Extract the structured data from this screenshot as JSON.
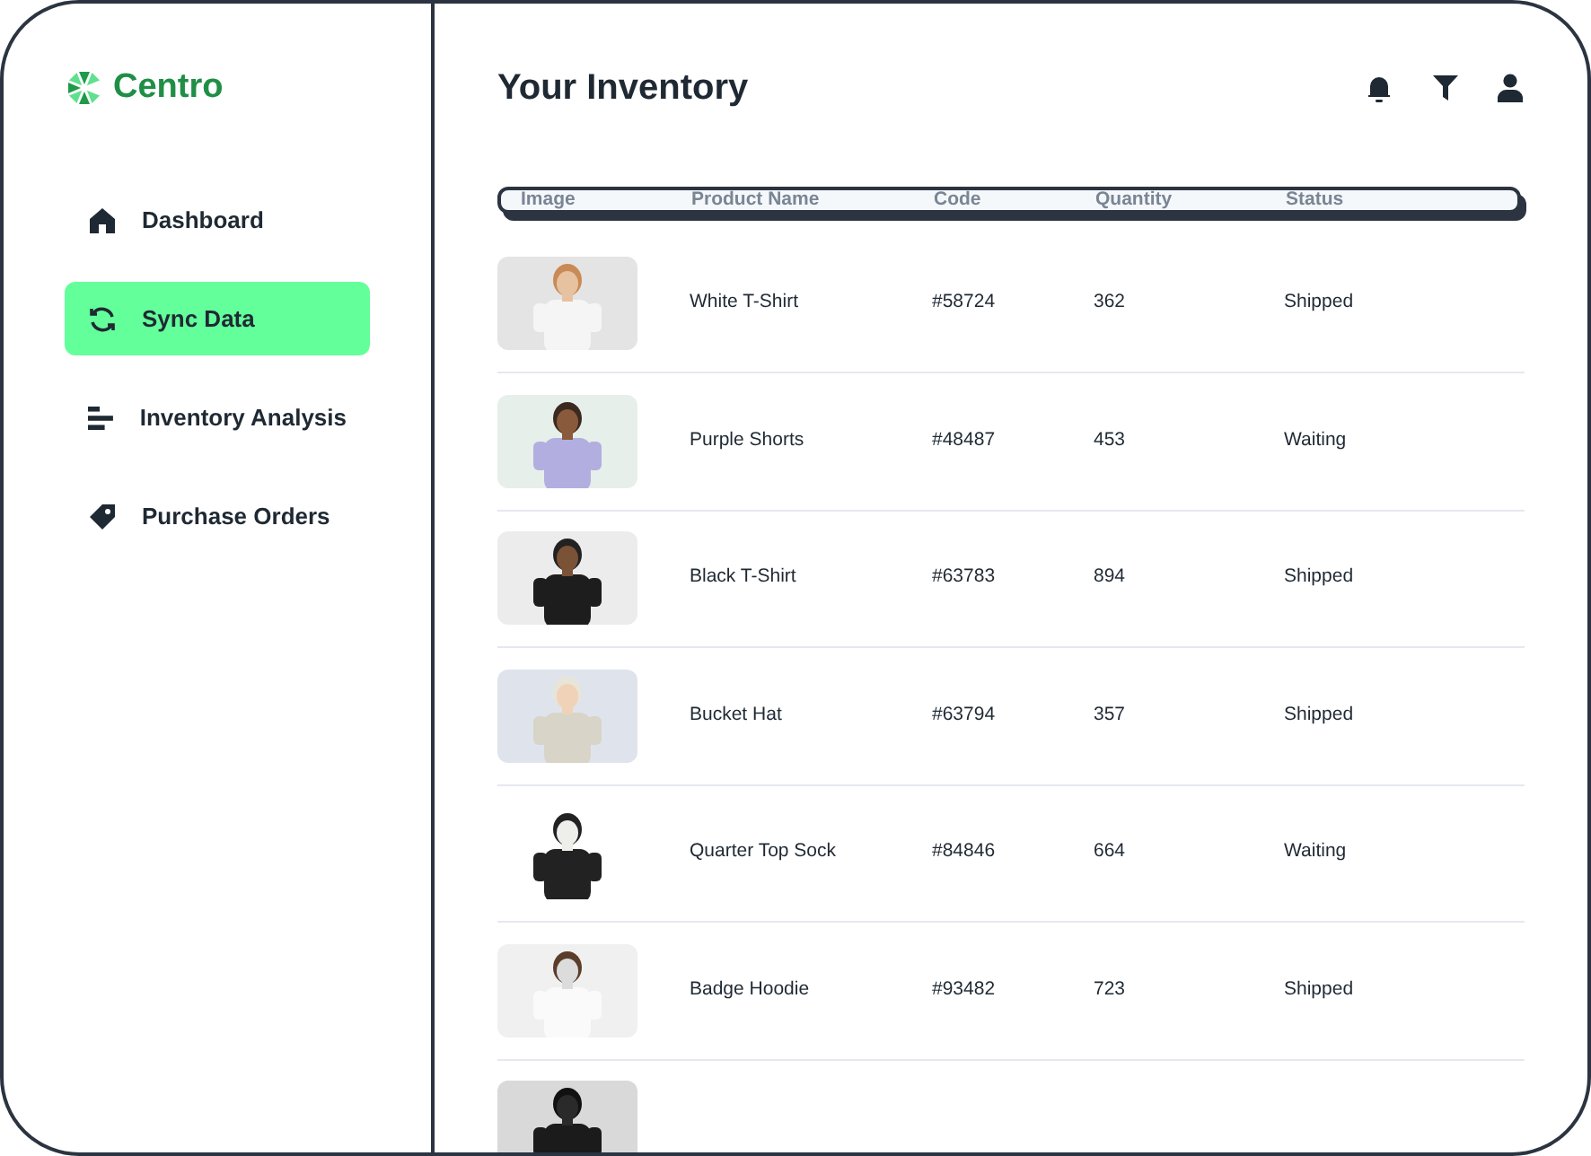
{
  "brand": {
    "name": "Centro"
  },
  "sidebar": {
    "items": [
      {
        "label": "Dashboard",
        "kind": "home",
        "selected": false
      },
      {
        "label": "Sync Data",
        "kind": "sync",
        "selected": true
      },
      {
        "label": "Inventory Analysis",
        "kind": "bars",
        "selected": false
      },
      {
        "label": "Purchase Orders",
        "kind": "tag",
        "selected": false
      }
    ]
  },
  "page": {
    "title": "Your Inventory"
  },
  "table": {
    "columns": [
      "Image",
      "Product Name",
      "Code",
      "Quantity",
      "Status"
    ],
    "rows": [
      {
        "image": {
          "kind": "picture"
        },
        "name": "White T-Shirt",
        "code": "#58724",
        "quantity": "362",
        "status": "Shipped"
      },
      {
        "image": {
          "kind": "picture"
        },
        "name": "Purple Shorts",
        "code": "#48487",
        "quantity": "453",
        "status": "Waiting"
      },
      {
        "image": {
          "kind": "picture"
        },
        "name": "Black T-Shirt",
        "code": "#63783",
        "quantity": "894",
        "status": "Shipped"
      },
      {
        "image": {
          "kind": "picture"
        },
        "name": "Bucket Hat",
        "code": "#63794",
        "quantity": "357",
        "status": "Shipped"
      },
      {
        "image": {
          "kind": "picture"
        },
        "name": "Quarter Top Sock",
        "code": "#84846",
        "quantity": "664",
        "status": "Waiting"
      },
      {
        "image": {
          "kind": "picture"
        },
        "name": "Badge Hoodie",
        "code": "#93482",
        "quantity": "723",
        "status": "Shipped"
      },
      {
        "image": {
          "kind": "picture"
        }
      }
    ]
  }
}
